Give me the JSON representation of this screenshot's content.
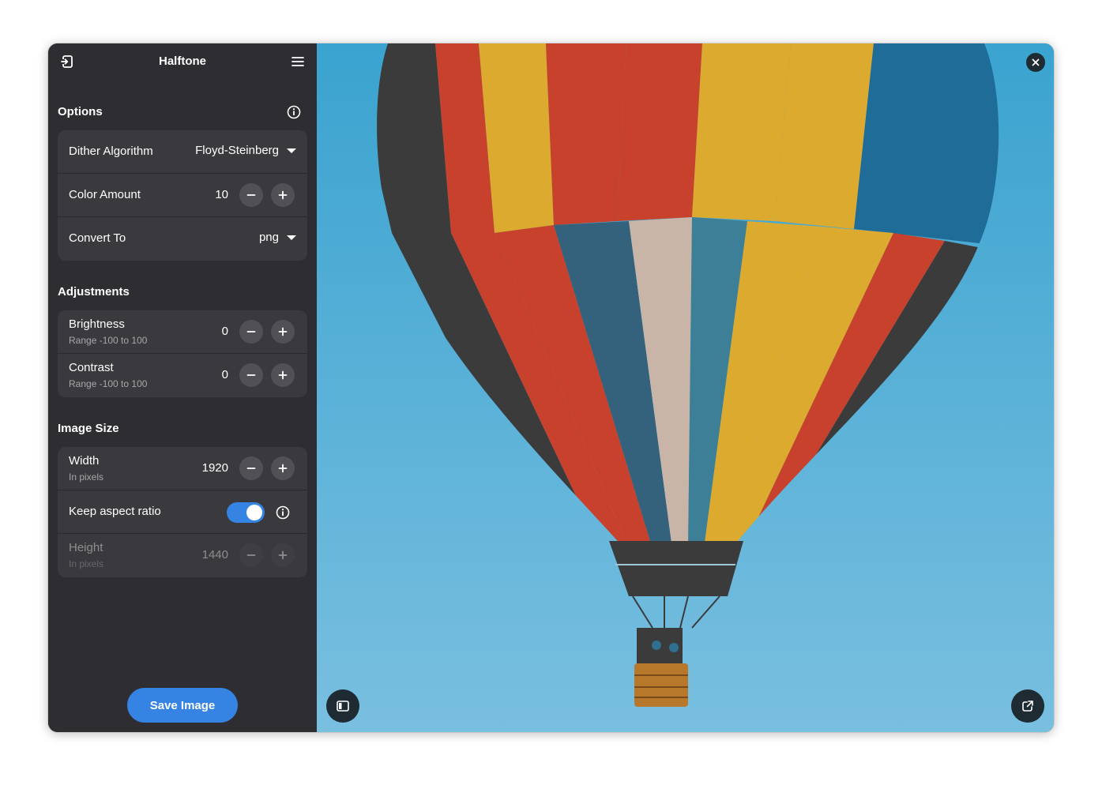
{
  "app": {
    "title": "Halftone"
  },
  "icons": {
    "open": "open-file-icon",
    "menu": "hamburger-menu-icon",
    "info": "info-icon",
    "minus": "minus-icon",
    "plus": "plus-icon",
    "sidebar_toggle": "sidebar-toggle-icon",
    "external": "open-external-icon",
    "close": "close-icon"
  },
  "options": {
    "title": "Options",
    "dither_label": "Dither Algorithm",
    "dither_value": "Floyd-Steinberg",
    "color_label": "Color Amount",
    "color_value": "10",
    "convert_label": "Convert To",
    "convert_value": "png"
  },
  "adjustments": {
    "title": "Adjustments",
    "brightness_label": "Brightness",
    "brightness_sub": "Range -100 to 100",
    "brightness_value": "0",
    "contrast_label": "Contrast",
    "contrast_sub": "Range -100 to 100",
    "contrast_value": "0"
  },
  "image_size": {
    "title": "Image Size",
    "width_label": "Width",
    "width_sub": "In pixels",
    "width_value": "1920",
    "aspect_label": "Keep aspect ratio",
    "aspect_on": true,
    "height_label": "Height",
    "height_sub": "In pixels",
    "height_value": "1440"
  },
  "actions": {
    "save_label": "Save Image"
  },
  "colors": {
    "accent": "#3584e4",
    "sidebar_bg": "#2e2e32",
    "row_bg": "#3a3a3e",
    "sky": "#3aa3cf"
  }
}
